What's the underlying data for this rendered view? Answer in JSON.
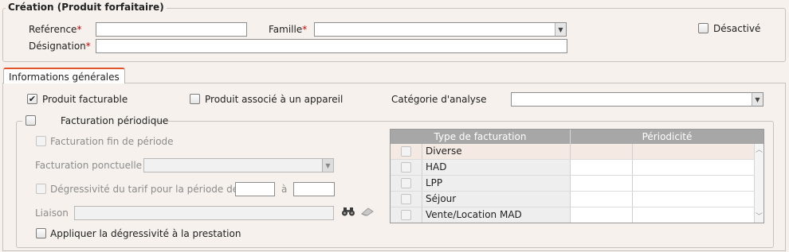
{
  "creation": {
    "legend": "Création (Produit forfaitaire)",
    "reference_label": "Reférence",
    "famille_label": "Famille",
    "designation_label": "Désignation",
    "required_mark": "*",
    "desactive_label": "Désactivé"
  },
  "tab": {
    "label": "Informations générales"
  },
  "general": {
    "produit_facturable": "Produit facturable",
    "produit_associe": "Produit associé à un appareil",
    "categorie_label": "Catégorie d'analyse"
  },
  "facturation": {
    "legend": "Facturation périodique",
    "fin_periode": "Facturation fin de période",
    "ponctuelle_label": "Facturation ponctuelle",
    "degressivite": "Dégressivité du tarif pour la période de",
    "a_label": "à",
    "liaison_label": "Liaison",
    "appliquer": "Appliquer la dégressivité à la prestation"
  },
  "grid": {
    "headers": [
      "Type de facturation",
      "Périodicité"
    ],
    "rows": [
      "Diverse",
      "HAD",
      "LPP",
      "Séjour",
      "Vente/Location MAD"
    ]
  },
  "icons": {
    "select_arrow": "▼",
    "check": "✔",
    "scroll_up": "︿",
    "scroll_down": "﹀"
  }
}
